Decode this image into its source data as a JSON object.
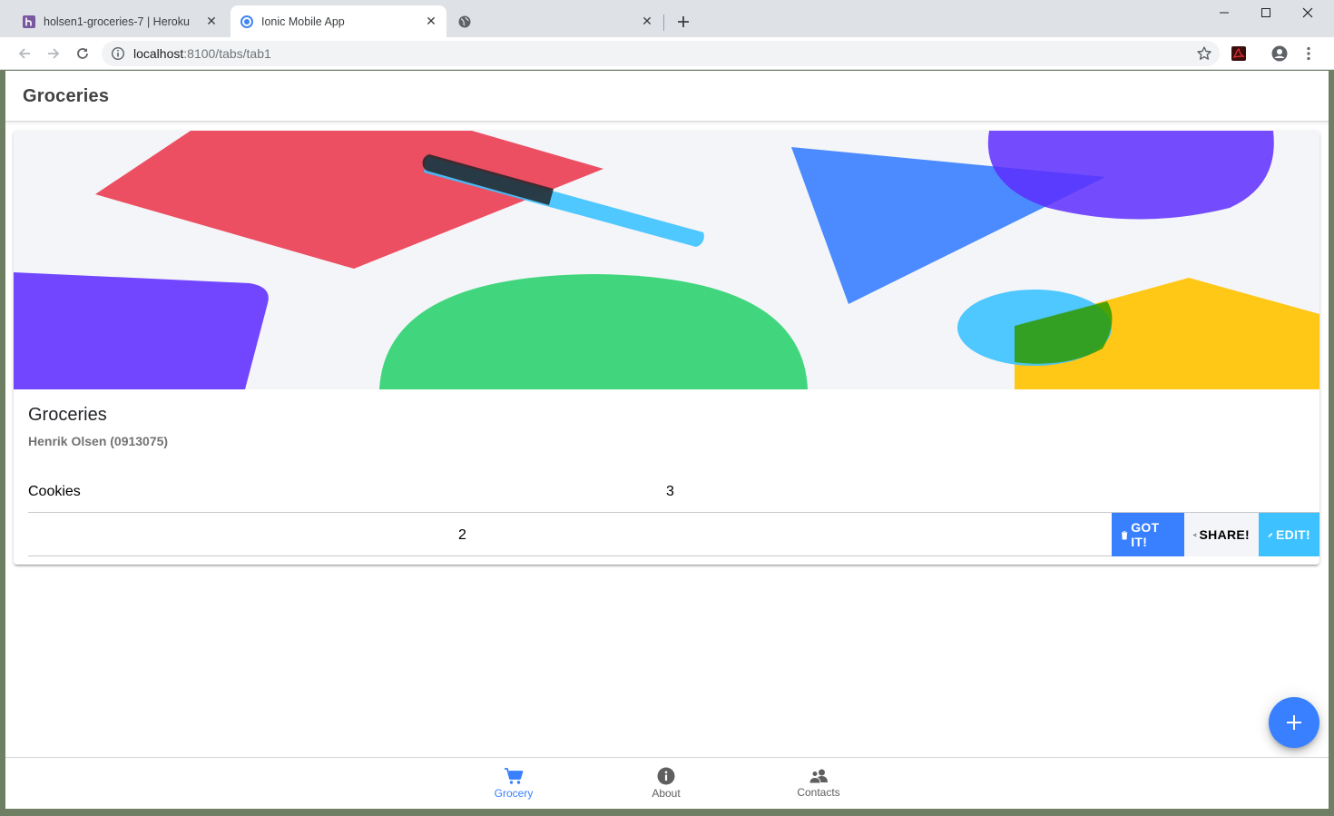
{
  "browser": {
    "tabs": [
      {
        "title": "holsen1-groceries-7 | Heroku",
        "favicon": "heroku-icon",
        "active": false
      },
      {
        "title": "Ionic Mobile App",
        "favicon": "chromium-icon",
        "active": true
      },
      {
        "title": "",
        "favicon": "globe-icon",
        "active": false
      }
    ],
    "url_host": "localhost",
    "url_rest": ":8100/tabs/tab1"
  },
  "app": {
    "header_title": "Groceries",
    "card": {
      "title": "Groceries",
      "subtitle": "Henrik Olsen (0913075)"
    },
    "items": [
      {
        "name": "Cookies",
        "quantity": "3"
      },
      {
        "name": "",
        "quantity": "2"
      }
    ],
    "item_options": {
      "got_it": "GOT IT!",
      "share": "SHARE!",
      "edit": "EDIT!"
    },
    "tabs": [
      {
        "label": "Grocery",
        "icon": "cart-icon",
        "selected": true
      },
      {
        "label": "About",
        "icon": "info-icon",
        "selected": false
      },
      {
        "label": "Contacts",
        "icon": "people-icon",
        "selected": false
      }
    ],
    "colors": {
      "primary": "#3880ff",
      "secondary": "#3dc2ff",
      "light": "#f4f5f8"
    }
  }
}
